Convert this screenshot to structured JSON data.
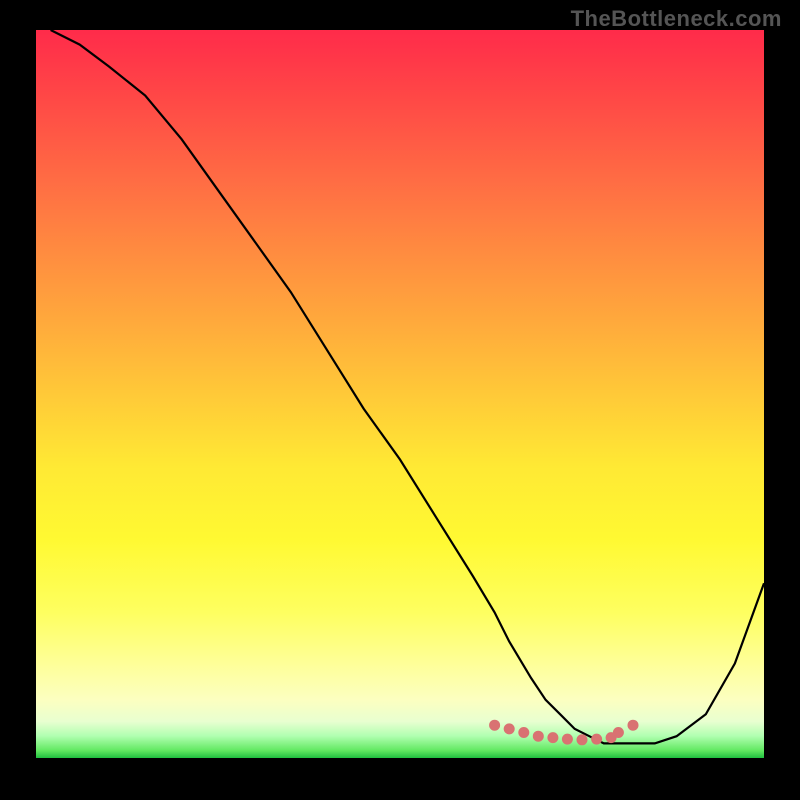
{
  "watermark": "TheBottleneck.com",
  "chart_data": {
    "type": "line",
    "title": "",
    "xlabel": "",
    "ylabel": "",
    "xlim": [
      0,
      100
    ],
    "ylim": [
      0,
      100
    ],
    "series": [
      {
        "name": "curve",
        "x": [
          2,
          6,
          10,
          15,
          20,
          25,
          30,
          35,
          40,
          45,
          50,
          55,
          60,
          63,
          65,
          68,
          70,
          72,
          74,
          76,
          78,
          80,
          82,
          85,
          88,
          92,
          96,
          100
        ],
        "y": [
          100,
          98,
          95,
          91,
          85,
          78,
          71,
          64,
          56,
          48,
          41,
          33,
          25,
          20,
          16,
          11,
          8,
          6,
          4,
          3,
          2,
          2,
          2,
          2,
          3,
          6,
          13,
          24
        ]
      }
    ],
    "highlight_points": {
      "x": [
        63,
        65,
        67,
        69,
        71,
        73,
        75,
        77,
        79,
        80,
        82
      ],
      "y": [
        4.5,
        4,
        3.5,
        3,
        2.8,
        2.6,
        2.5,
        2.6,
        2.8,
        3.5,
        4.5
      ]
    }
  }
}
